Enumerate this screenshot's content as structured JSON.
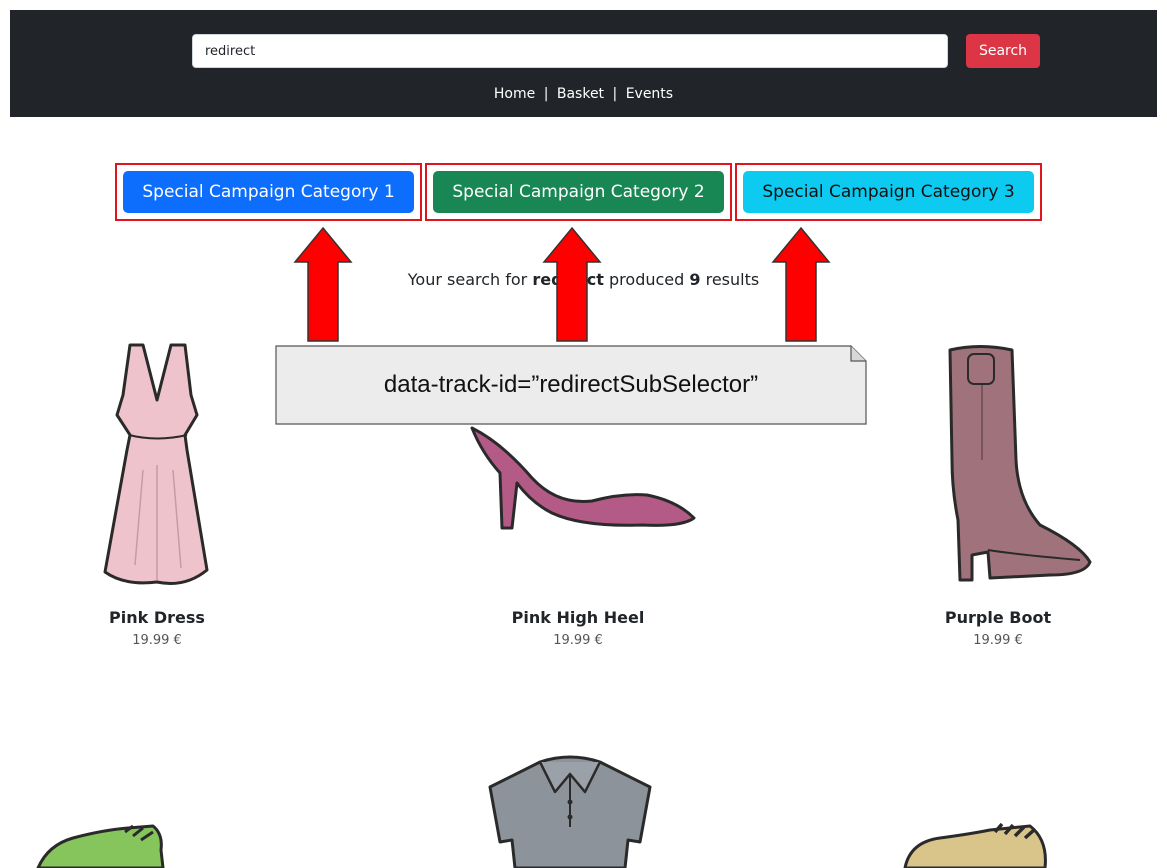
{
  "header": {
    "search_value": "redirect",
    "search_button": "Search",
    "nav": [
      "Home",
      "Basket",
      "Events"
    ],
    "nav_separator": "|"
  },
  "campaigns": [
    {
      "label": "Special Campaign Category 1",
      "color": "#0d6efd"
    },
    {
      "label": "Special Campaign Category 2",
      "color": "#198754"
    },
    {
      "label": "Special Campaign Category 3",
      "color": "#0dcaf0"
    }
  ],
  "search_result": {
    "prefix": "Your search for",
    "term": "redirect",
    "middle": "produced",
    "count": "9",
    "suffix": "results"
  },
  "annotation": {
    "text": "data-track-id=”redirectSubSelector”",
    "highlight_color": "#e0141c"
  },
  "products": [
    {
      "name": "Pink Dress",
      "price": "19.99 €",
      "icon": "dress-icon"
    },
    {
      "name": "Pink High Heel",
      "price": "19.99 €",
      "icon": "high-heel-icon"
    },
    {
      "name": "Purple Boot",
      "price": "19.99 €",
      "icon": "boot-icon"
    },
    {
      "name": "",
      "price": "",
      "icon": "green-sneaker-icon"
    },
    {
      "name": "",
      "price": "",
      "icon": "polo-shirt-icon"
    },
    {
      "name": "",
      "price": "",
      "icon": "beige-shoe-icon"
    }
  ]
}
